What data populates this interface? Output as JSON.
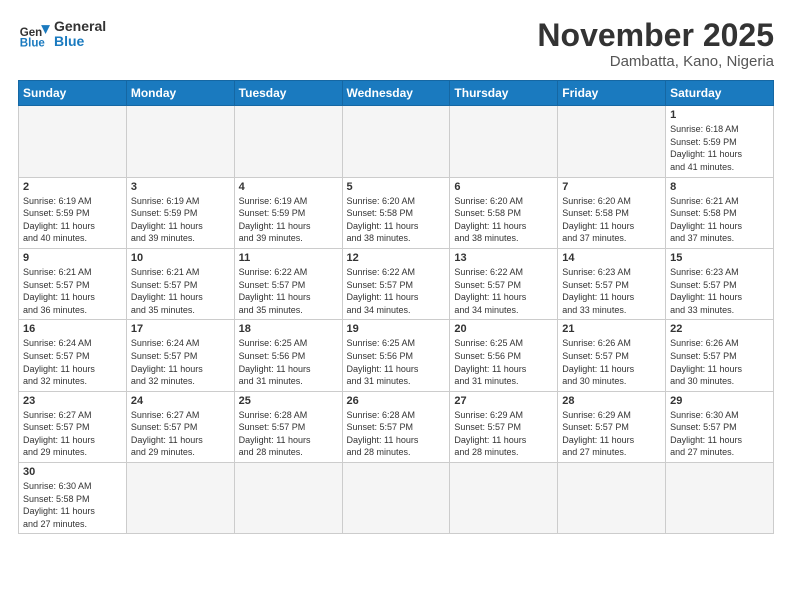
{
  "logo": {
    "text_general": "General",
    "text_blue": "Blue"
  },
  "header": {
    "month": "November 2025",
    "location": "Dambatta, Kano, Nigeria"
  },
  "weekdays": [
    "Sunday",
    "Monday",
    "Tuesday",
    "Wednesday",
    "Thursday",
    "Friday",
    "Saturday"
  ],
  "weeks": [
    [
      {
        "day": "",
        "info": ""
      },
      {
        "day": "",
        "info": ""
      },
      {
        "day": "",
        "info": ""
      },
      {
        "day": "",
        "info": ""
      },
      {
        "day": "",
        "info": ""
      },
      {
        "day": "",
        "info": ""
      },
      {
        "day": "1",
        "info": "Sunrise: 6:18 AM\nSunset: 5:59 PM\nDaylight: 11 hours\nand 41 minutes."
      }
    ],
    [
      {
        "day": "2",
        "info": "Sunrise: 6:19 AM\nSunset: 5:59 PM\nDaylight: 11 hours\nand 40 minutes."
      },
      {
        "day": "3",
        "info": "Sunrise: 6:19 AM\nSunset: 5:59 PM\nDaylight: 11 hours\nand 39 minutes."
      },
      {
        "day": "4",
        "info": "Sunrise: 6:19 AM\nSunset: 5:59 PM\nDaylight: 11 hours\nand 39 minutes."
      },
      {
        "day": "5",
        "info": "Sunrise: 6:20 AM\nSunset: 5:58 PM\nDaylight: 11 hours\nand 38 minutes."
      },
      {
        "day": "6",
        "info": "Sunrise: 6:20 AM\nSunset: 5:58 PM\nDaylight: 11 hours\nand 38 minutes."
      },
      {
        "day": "7",
        "info": "Sunrise: 6:20 AM\nSunset: 5:58 PM\nDaylight: 11 hours\nand 37 minutes."
      },
      {
        "day": "8",
        "info": "Sunrise: 6:21 AM\nSunset: 5:58 PM\nDaylight: 11 hours\nand 37 minutes."
      }
    ],
    [
      {
        "day": "9",
        "info": "Sunrise: 6:21 AM\nSunset: 5:57 PM\nDaylight: 11 hours\nand 36 minutes."
      },
      {
        "day": "10",
        "info": "Sunrise: 6:21 AM\nSunset: 5:57 PM\nDaylight: 11 hours\nand 35 minutes."
      },
      {
        "day": "11",
        "info": "Sunrise: 6:22 AM\nSunset: 5:57 PM\nDaylight: 11 hours\nand 35 minutes."
      },
      {
        "day": "12",
        "info": "Sunrise: 6:22 AM\nSunset: 5:57 PM\nDaylight: 11 hours\nand 34 minutes."
      },
      {
        "day": "13",
        "info": "Sunrise: 6:22 AM\nSunset: 5:57 PM\nDaylight: 11 hours\nand 34 minutes."
      },
      {
        "day": "14",
        "info": "Sunrise: 6:23 AM\nSunset: 5:57 PM\nDaylight: 11 hours\nand 33 minutes."
      },
      {
        "day": "15",
        "info": "Sunrise: 6:23 AM\nSunset: 5:57 PM\nDaylight: 11 hours\nand 33 minutes."
      }
    ],
    [
      {
        "day": "16",
        "info": "Sunrise: 6:24 AM\nSunset: 5:57 PM\nDaylight: 11 hours\nand 32 minutes."
      },
      {
        "day": "17",
        "info": "Sunrise: 6:24 AM\nSunset: 5:57 PM\nDaylight: 11 hours\nand 32 minutes."
      },
      {
        "day": "18",
        "info": "Sunrise: 6:25 AM\nSunset: 5:56 PM\nDaylight: 11 hours\nand 31 minutes."
      },
      {
        "day": "19",
        "info": "Sunrise: 6:25 AM\nSunset: 5:56 PM\nDaylight: 11 hours\nand 31 minutes."
      },
      {
        "day": "20",
        "info": "Sunrise: 6:25 AM\nSunset: 5:56 PM\nDaylight: 11 hours\nand 31 minutes."
      },
      {
        "day": "21",
        "info": "Sunrise: 6:26 AM\nSunset: 5:57 PM\nDaylight: 11 hours\nand 30 minutes."
      },
      {
        "day": "22",
        "info": "Sunrise: 6:26 AM\nSunset: 5:57 PM\nDaylight: 11 hours\nand 30 minutes."
      }
    ],
    [
      {
        "day": "23",
        "info": "Sunrise: 6:27 AM\nSunset: 5:57 PM\nDaylight: 11 hours\nand 29 minutes."
      },
      {
        "day": "24",
        "info": "Sunrise: 6:27 AM\nSunset: 5:57 PM\nDaylight: 11 hours\nand 29 minutes."
      },
      {
        "day": "25",
        "info": "Sunrise: 6:28 AM\nSunset: 5:57 PM\nDaylight: 11 hours\nand 28 minutes."
      },
      {
        "day": "26",
        "info": "Sunrise: 6:28 AM\nSunset: 5:57 PM\nDaylight: 11 hours\nand 28 minutes."
      },
      {
        "day": "27",
        "info": "Sunrise: 6:29 AM\nSunset: 5:57 PM\nDaylight: 11 hours\nand 28 minutes."
      },
      {
        "day": "28",
        "info": "Sunrise: 6:29 AM\nSunset: 5:57 PM\nDaylight: 11 hours\nand 27 minutes."
      },
      {
        "day": "29",
        "info": "Sunrise: 6:30 AM\nSunset: 5:57 PM\nDaylight: 11 hours\nand 27 minutes."
      }
    ],
    [
      {
        "day": "30",
        "info": "Sunrise: 6:30 AM\nSunset: 5:58 PM\nDaylight: 11 hours\nand 27 minutes."
      },
      {
        "day": "",
        "info": ""
      },
      {
        "day": "",
        "info": ""
      },
      {
        "day": "",
        "info": ""
      },
      {
        "day": "",
        "info": ""
      },
      {
        "day": "",
        "info": ""
      },
      {
        "day": "",
        "info": ""
      }
    ]
  ]
}
